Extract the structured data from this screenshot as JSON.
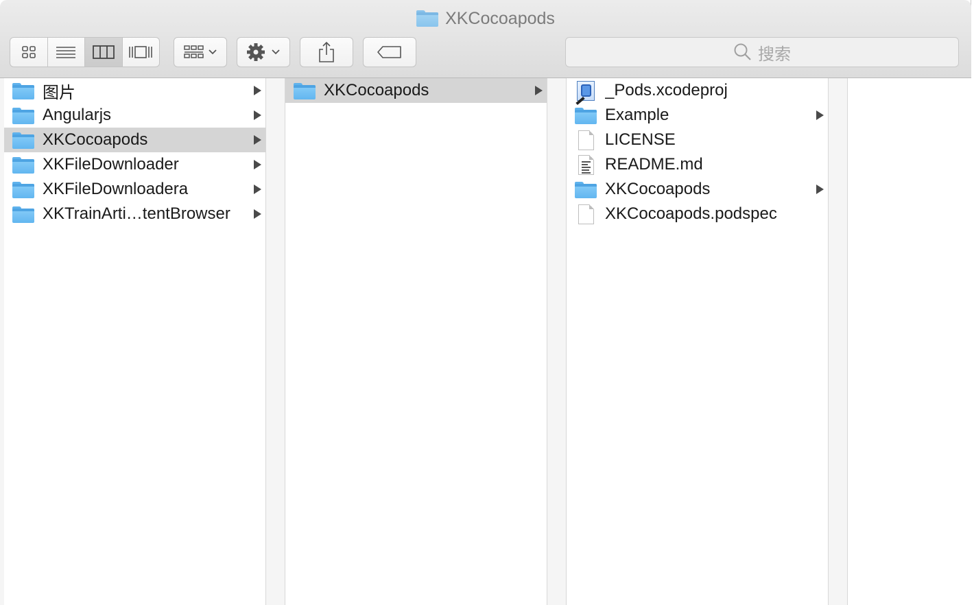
{
  "window": {
    "title": "XKCocoapods"
  },
  "toolbar": {
    "view_modes": [
      {
        "name": "icon-view",
        "active": false
      },
      {
        "name": "list-view",
        "active": false
      },
      {
        "name": "column-view",
        "active": true
      },
      {
        "name": "cover-flow-view",
        "active": false
      }
    ],
    "search": {
      "placeholder": "搜索"
    }
  },
  "columns": [
    {
      "items": [
        {
          "label": "图片",
          "icon": "folder-icon",
          "has_children": true,
          "selected": false
        },
        {
          "label": "Angularjs",
          "icon": "folder-icon",
          "has_children": true,
          "selected": false
        },
        {
          "label": "XKCocoapods",
          "icon": "folder-icon",
          "has_children": true,
          "selected": true
        },
        {
          "label": "XKFileDownloader",
          "icon": "folder-icon",
          "has_children": true,
          "selected": false
        },
        {
          "label": "XKFileDownloadera",
          "icon": "folder-icon",
          "has_children": true,
          "selected": false
        },
        {
          "label": "XKTrainArti…tentBrowser",
          "icon": "folder-icon",
          "has_children": true,
          "selected": false
        }
      ]
    },
    {
      "items": [
        {
          "label": "XKCocoapods",
          "icon": "folder-icon",
          "has_children": true,
          "selected": true
        }
      ]
    },
    {
      "items": [
        {
          "label": "_Pods.xcodeproj",
          "icon": "xcodeproj-icon",
          "has_children": false,
          "selected": false
        },
        {
          "label": "Example",
          "icon": "folder-icon",
          "has_children": true,
          "selected": false
        },
        {
          "label": "LICENSE",
          "icon": "document-icon",
          "has_children": false,
          "selected": false
        },
        {
          "label": "README.md",
          "icon": "text-document-icon",
          "has_children": false,
          "selected": false
        },
        {
          "label": "XKCocoapods",
          "icon": "folder-icon",
          "has_children": true,
          "selected": false
        },
        {
          "label": "XKCocoapods.podspec",
          "icon": "document-icon",
          "has_children": false,
          "selected": false
        }
      ]
    }
  ],
  "colors": {
    "selection": "#d5d5d5",
    "folder": "#62b6f0",
    "toolbar_top": "#ececec",
    "toolbar_bottom": "#dcdcdc"
  }
}
